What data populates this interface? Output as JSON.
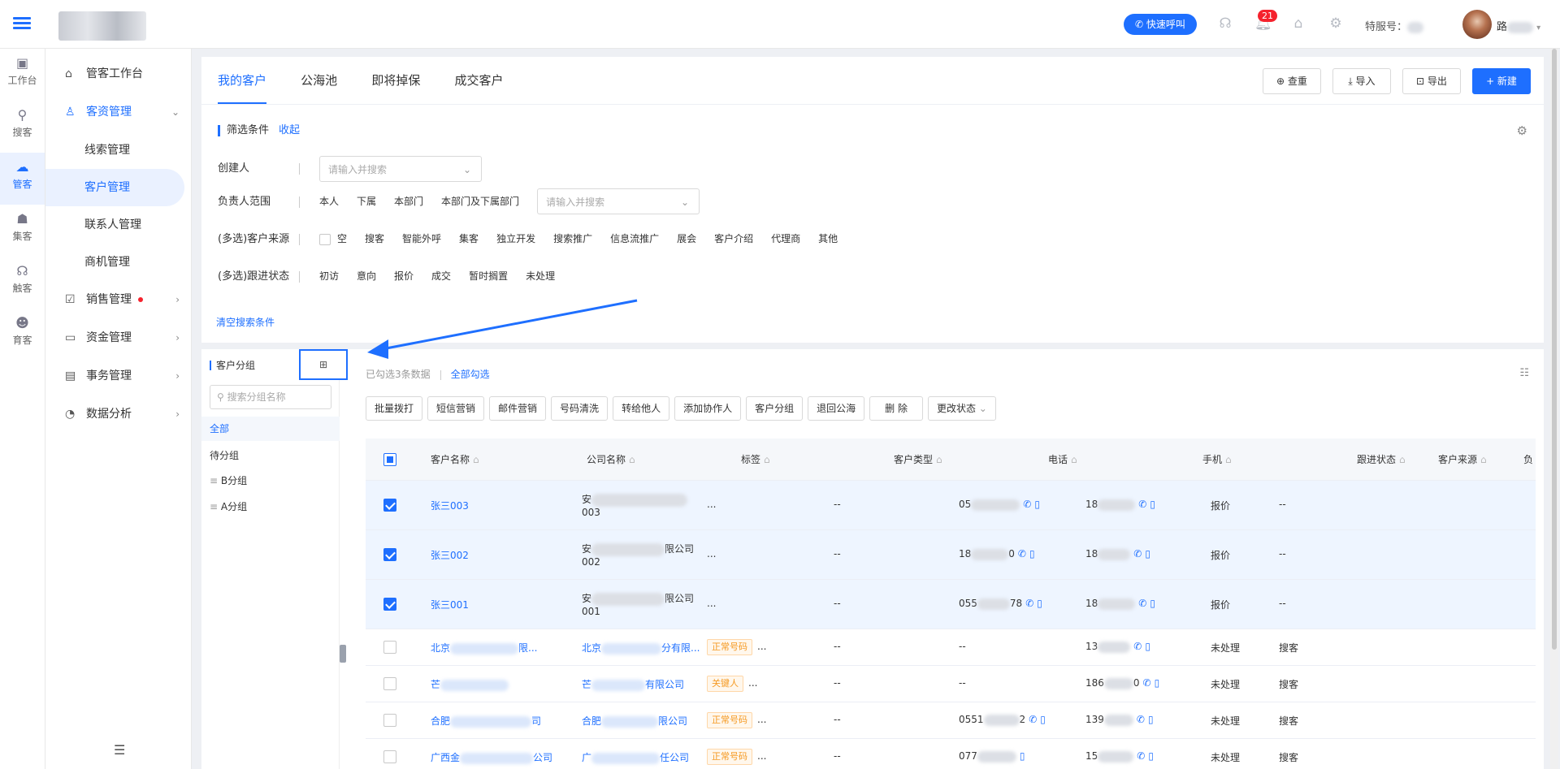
{
  "topbar": {
    "call_button": "快速呼叫",
    "badge": "21",
    "hotline_label": "特服号：",
    "user_initial": "路"
  },
  "rail": [
    {
      "label": "工作台",
      "icon": "desk-icon"
    },
    {
      "label": "搜客",
      "icon": "search-user-icon"
    },
    {
      "label": "管客",
      "icon": "cloud-icon",
      "active": true
    },
    {
      "label": "集客",
      "icon": "group-icon"
    },
    {
      "label": "触客",
      "icon": "headset-icon"
    },
    {
      "label": "育客",
      "icon": "users-icon"
    }
  ],
  "sidebar": {
    "items": [
      {
        "label": "管客工作台"
      },
      {
        "label": "客资管理"
      },
      {
        "label": "线索管理"
      },
      {
        "label": "客户管理"
      },
      {
        "label": "联系人管理"
      },
      {
        "label": "商机管理"
      },
      {
        "label": "销售管理"
      },
      {
        "label": "资金管理"
      },
      {
        "label": "事务管理"
      },
      {
        "label": "数据分析"
      }
    ]
  },
  "tabs": [
    "我的客户",
    "公海池",
    "即将掉保",
    "成交客户"
  ],
  "toolbar": {
    "check": "查重",
    "import": "导入",
    "export": "导出",
    "new": "+ 新建"
  },
  "filter": {
    "title": "筛选条件",
    "collapse": "收起",
    "creator_label": "创建人",
    "creator_placeholder": "请输入并搜索",
    "owner_label": "负责人范围",
    "owner_options": [
      "本人",
      "下属",
      "本部门",
      "本部门及下属部门"
    ],
    "owner_placeholder": "请输入并搜索",
    "source_label": "(多选)客户来源",
    "source_options": [
      "空",
      "搜客",
      "智能外呼",
      "集客",
      "独立开发",
      "搜索推广",
      "信息流推广",
      "展会",
      "客户介绍",
      "代理商",
      "其他"
    ],
    "status_label": "(多选)跟进状态",
    "status_options": [
      "初访",
      "意向",
      "报价",
      "成交",
      "暂时搁置",
      "未处理"
    ],
    "clear": "清空搜索条件"
  },
  "groups": {
    "title": "客户分组",
    "add_icon": "⊞",
    "search_placeholder": "搜索分组名称",
    "items": [
      "全部",
      "待分组",
      "B分组",
      "A分组"
    ]
  },
  "table_info": {
    "selected": "已勾选3条数据",
    "select_all": "全部勾选"
  },
  "actions": [
    "批量拨打",
    "短信营销",
    "邮件营销",
    "号码清洗",
    "转给他人",
    "添加协作人",
    "客户分组",
    "退回公海",
    "删 除",
    "更改状态"
  ],
  "columns": [
    "客户名称",
    "公司名称",
    "标签",
    "客户类型",
    "电话",
    "手机",
    "跟进状态",
    "客户来源",
    "负"
  ],
  "rows": [
    {
      "name": "张三003",
      "company1": "安",
      "company2": "003",
      "tag": "...",
      "type": "--",
      "tel": "05",
      "mobile": "18",
      "status": "报价",
      "source": "--"
    },
    {
      "name": "张三002",
      "company1": "安",
      "company_tail": "限公司",
      "company2": "002",
      "tag": "...",
      "type": "--",
      "tel": "18",
      "tel_tail": "0",
      "mobile": "18",
      "status": "报价",
      "source": "--"
    },
    {
      "name": "张三001",
      "company1": "安",
      "company_tail": "限公司",
      "company2": "001",
      "tag": "...",
      "type": "--",
      "tel": "055",
      "tel_tail": "78",
      "mobile": "18",
      "status": "报价",
      "source": "--"
    },
    {
      "name": "北京",
      "name_tail": "限...",
      "company1": "北京",
      "company_tail": "分有限...",
      "tag_label": "正常号码",
      "tag": "...",
      "type": "--",
      "tel": "--",
      "mobile": "13",
      "status": "未处理",
      "source": "搜客"
    },
    {
      "name": "芒",
      "company1": "芒",
      "company_tail": "有限公司",
      "tag_label": "关键人",
      "tag": "...",
      "type": "--",
      "tel": "--",
      "mobile": "186",
      "mobile_tail": "0",
      "status": "未处理",
      "source": "搜客"
    },
    {
      "name": "合肥",
      "name_tail": "司",
      "company1": "合肥",
      "company_tail": "限公司",
      "tag_label": "正常号码",
      "tag": "...",
      "type": "--",
      "tel": "0551",
      "tel_tail": "2",
      "mobile": "139",
      "status": "未处理",
      "source": "搜客"
    },
    {
      "name": "广西金",
      "name_tail": "公司",
      "company1": "广",
      "company_tail": "任公司",
      "tag_label": "正常号码",
      "tag": "...",
      "type": "--",
      "tel": "077",
      "mobile": "15",
      "status": "未处理",
      "source": "搜客"
    }
  ],
  "colors": {
    "accent": "#1e6fff",
    "tag_orange": "#f59a23",
    "badge_red": "#f5222d"
  }
}
